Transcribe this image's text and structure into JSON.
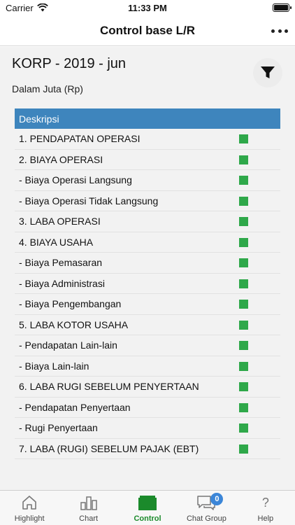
{
  "status_bar": {
    "carrier": "Carrier",
    "time": "11:33 PM"
  },
  "nav": {
    "title": "Control base L/R"
  },
  "report": {
    "title": "KORP - 2019 - jun",
    "subtitle": "Dalam Juta (Rp)"
  },
  "table": {
    "header": "Deskripsi",
    "indicator_color": "#2fa84a",
    "rows": [
      "1. PENDAPATAN OPERASI",
      "2. BIAYA OPERASI",
      "- Biaya Operasi Langsung",
      "- Biaya Operasi Tidak Langsung",
      "3. LABA OPERASI",
      "4. BIAYA USAHA",
      "- Biaya Pemasaran",
      "- Biaya Administrasi",
      "- Biaya Pengembangan",
      "5. LABA KOTOR USAHA",
      "- Pendapatan Lain-lain",
      "- Biaya Lain-lain",
      "6. LABA RUGI SEBELUM PENYERTAAN",
      "- Pendapatan Penyertaan",
      "- Rugi Penyertaan",
      "7. LABA (RUGI) SEBELUM PAJAK (EBT)"
    ]
  },
  "tabs": [
    {
      "label": "Highlight",
      "icon": "house-icon"
    },
    {
      "label": "Chart",
      "icon": "bar-chart-icon"
    },
    {
      "label": "Control",
      "icon": "control-icon",
      "active": true
    },
    {
      "label": "Chat Group",
      "icon": "chat-icon",
      "badge": "0"
    },
    {
      "label": "Help",
      "icon": "question-icon"
    }
  ],
  "colors": {
    "header": "#3e85bd",
    "active_tab": "#1b8a2b",
    "badge": "#3b86d8"
  }
}
